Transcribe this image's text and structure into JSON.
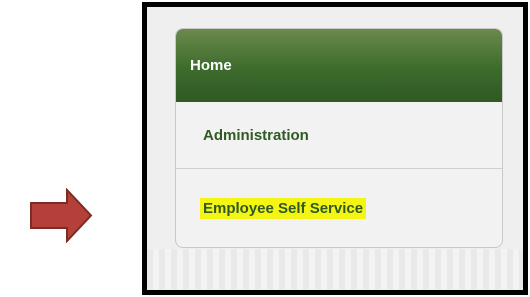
{
  "menu": {
    "header_label": "Home",
    "items": [
      {
        "label": "Administration",
        "highlighted": false
      },
      {
        "label": "Employee Self Service",
        "highlighted": true
      }
    ]
  },
  "colors": {
    "header_green": "#3d6b2c",
    "item_text_green": "#2e5a23",
    "highlight_yellow": "#f5f514",
    "arrow_red": "#b5403a"
  },
  "icons": {
    "pointer": "right-arrow-icon"
  }
}
